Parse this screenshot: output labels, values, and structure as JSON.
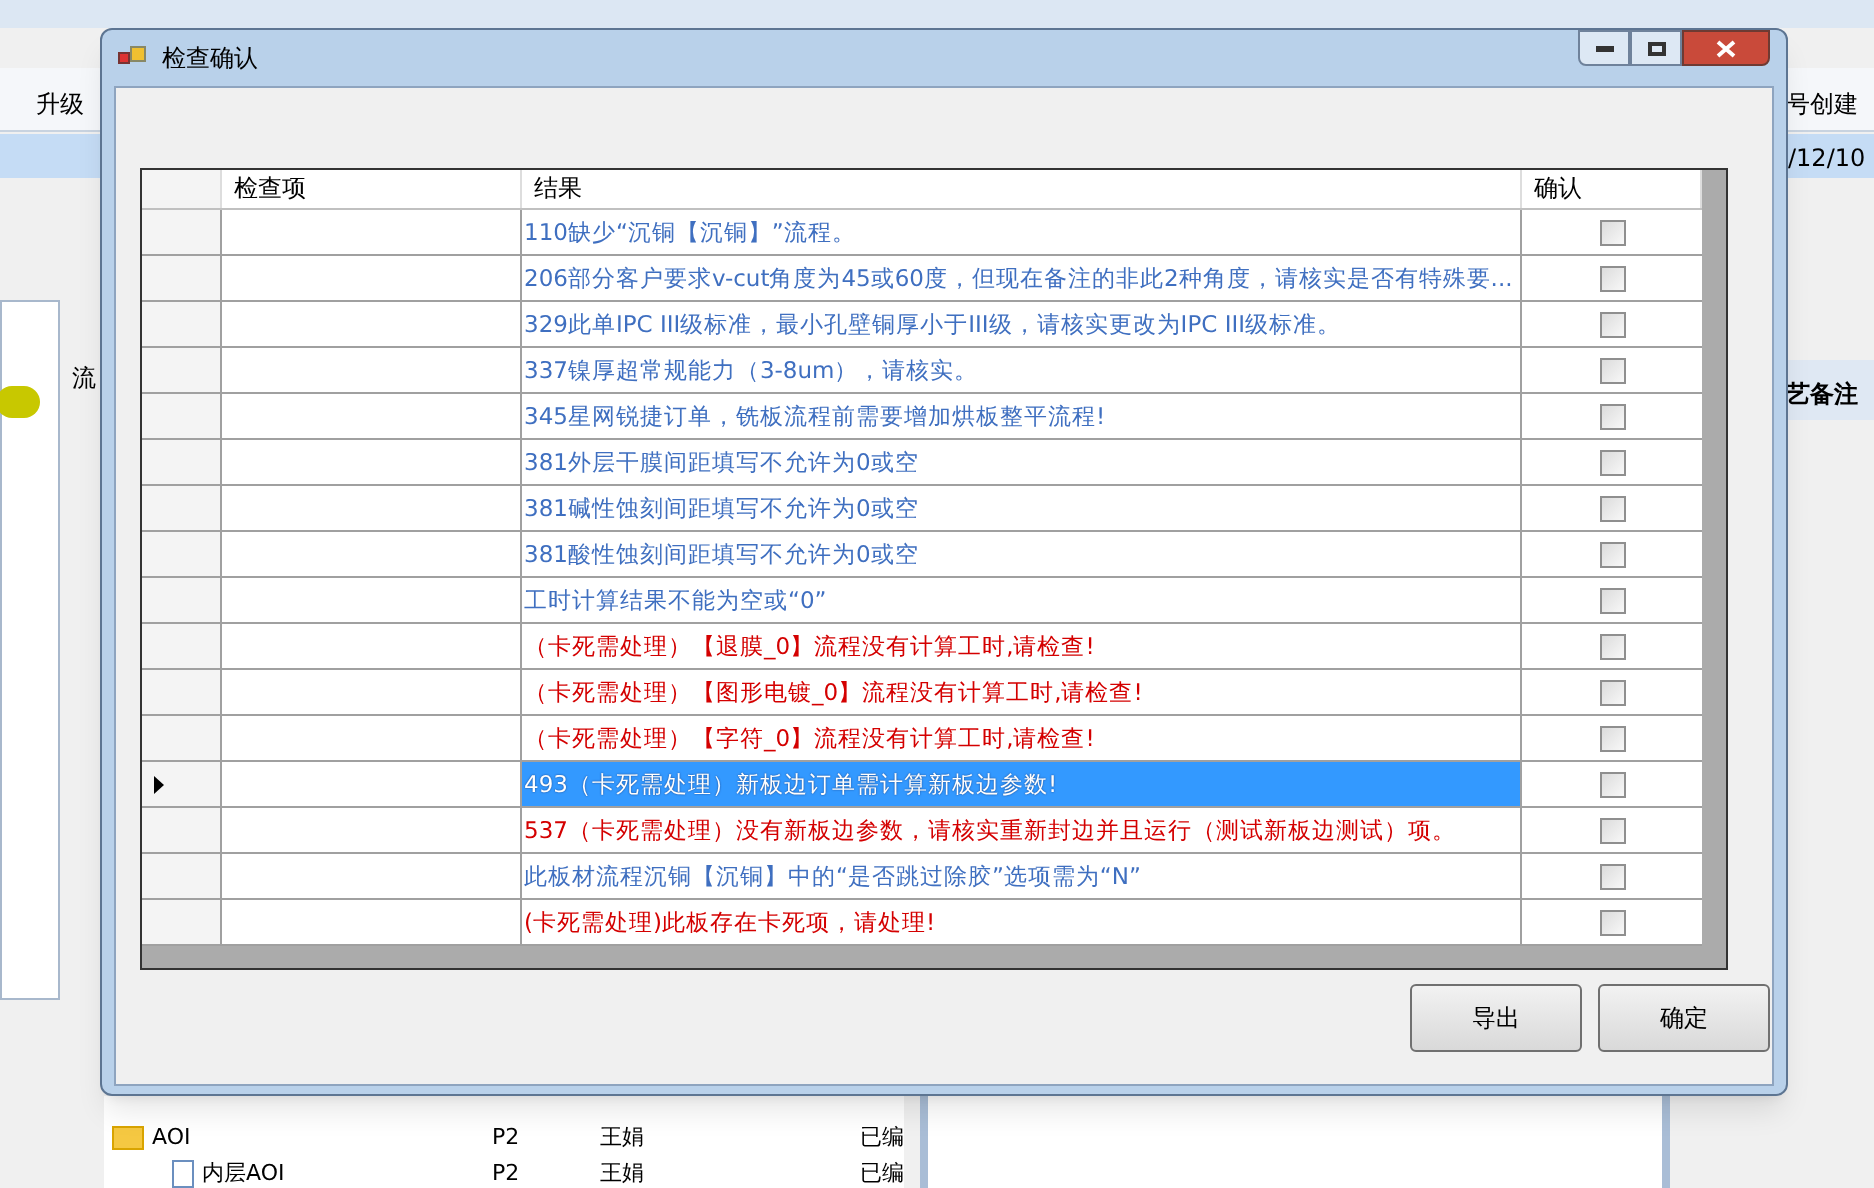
{
  "background": {
    "left_header": "升级",
    "right_header": "号创建",
    "right_date": "/12/10",
    "right_column": "艺备注",
    "tree_header": "流",
    "tree_rows": [
      {
        "kind": "folder",
        "name": "AOI",
        "col2": "P2",
        "col3": "王娟",
        "col4": "已编"
      },
      {
        "kind": "file",
        "name": "内层AOI",
        "col2": "P2",
        "col3": "王娟",
        "col4": "已编"
      }
    ]
  },
  "dialog": {
    "title": "检查确认",
    "table": {
      "columns": [
        "检查项",
        "结果",
        "确认"
      ],
      "rows": [
        {
          "item": "",
          "result": "110缺少“沉铜【沉铜】”流程。",
          "kind": "info",
          "selected": false,
          "checked": false
        },
        {
          "item": "",
          "result": "206部分客户要求v-cut角度为45或60度，但现在备注的非此2种角度，请核实是否有特殊要...",
          "kind": "info",
          "selected": false,
          "checked": false
        },
        {
          "item": "",
          "result": "329此单IPC III级标准，最小孔壁铜厚小于III级，请核实更改为IPC III级标准。",
          "kind": "info",
          "selected": false,
          "checked": false
        },
        {
          "item": "",
          "result": "337镍厚超常规能力（3-8um），请核实。",
          "kind": "info",
          "selected": false,
          "checked": false
        },
        {
          "item": "",
          "result": "345星网锐捷订单，铣板流程前需要增加烘板整平流程!",
          "kind": "info",
          "selected": false,
          "checked": false
        },
        {
          "item": "",
          "result": "381外层干膜间距填写不允许为0或空",
          "kind": "info",
          "selected": false,
          "checked": false
        },
        {
          "item": "",
          "result": "381碱性蚀刻间距填写不允许为0或空",
          "kind": "info",
          "selected": false,
          "checked": false
        },
        {
          "item": "",
          "result": "381酸性蚀刻间距填写不允许为0或空",
          "kind": "info",
          "selected": false,
          "checked": false
        },
        {
          "item": "",
          "result": "工时计算结果不能为空或“0”",
          "kind": "info",
          "selected": false,
          "checked": false
        },
        {
          "item": "",
          "result": "（卡死需处理）【退膜_0】流程没有计算工时,请检查!",
          "kind": "blocking",
          "selected": false,
          "checked": false
        },
        {
          "item": "",
          "result": "（卡死需处理）【图形电镀_0】流程没有计算工时,请检查!",
          "kind": "blocking",
          "selected": false,
          "checked": false
        },
        {
          "item": "",
          "result": "（卡死需处理）【字符_0】流程没有计算工时,请检查!",
          "kind": "blocking",
          "selected": false,
          "checked": false
        },
        {
          "item": "",
          "result": "493（卡死需处理）新板边订单需计算新板边参数!",
          "kind": "blocking",
          "selected": true,
          "checked": false
        },
        {
          "item": "",
          "result": "537（卡死需处理）没有新板边参数，请核实重新封边并且运行（测试新板边测试）项。",
          "kind": "blocking",
          "selected": false,
          "checked": false
        },
        {
          "item": "",
          "result": "此板材流程沉铜【沉铜】中的“是否跳过除胶”选项需为“N”",
          "kind": "info",
          "selected": false,
          "checked": false
        },
        {
          "item": "",
          "result": "(卡死需处理)此板存在卡死项，请处理!",
          "kind": "blocking",
          "selected": false,
          "checked": false
        }
      ]
    },
    "buttons": [
      "导出",
      "确定"
    ]
  }
}
